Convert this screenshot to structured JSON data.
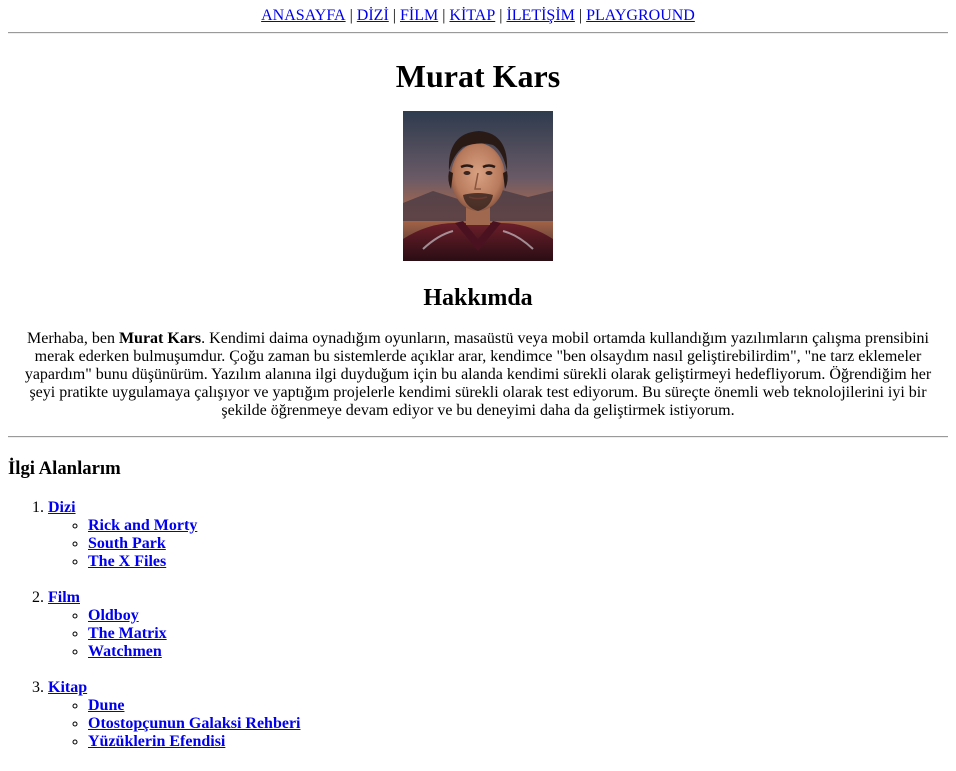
{
  "nav": {
    "links": [
      "ANASAYFA",
      "DİZİ",
      "FİLM",
      "KİTAP",
      "İLETİŞİM",
      "PLAYGROUND"
    ],
    "separator": "|"
  },
  "profile": {
    "name": "Murat Kars",
    "portrait_alt": "Murat Kars"
  },
  "about": {
    "heading": "Hakkımda",
    "intro": "Merhaba, ben ",
    "name_bold": "Murat Kars",
    "text": ". Kendimi daima oynadığım oyunların, masaüstü veya mobil ortamda kullandığım yazılımların çalışma prensibini merak ederken bulmuşumdur. Çoğu zaman bu sistemlerde açıklar arar, kendimce \"ben olsaydım nasıl geliştirebilirdim\", \"ne tarz eklemeler yapardım\" bunu düşünürüm. Yazılım alanına ilgi duyduğum için bu alanda kendimi sürekli olarak geliştirmeyi hedefliyorum. Öğrendiğim her şeyi pratikte uygulamaya çalışıyor ve yaptığım projelerle kendimi sürekli olarak test ediyorum. Bu süreçte önemli web teknolojilerini iyi bir şekilde öğrenmeye devam ediyor ve bu deneyimi daha da geliştirmek istiyorum."
  },
  "interests": {
    "heading": "İlgi Alanlarım",
    "categories": [
      {
        "label": "Dizi",
        "items": [
          "Rick and Morty",
          "South Park",
          "The X Files"
        ]
      },
      {
        "label": "Film",
        "items": [
          "Oldboy",
          "The Matrix",
          "Watchmen"
        ]
      },
      {
        "label": "Kitap",
        "items": [
          "Dune",
          "Otostopçunun Galaksi Rehberi",
          "Yüzüklerin Efendisi"
        ]
      }
    ]
  },
  "colors": {
    "link": "#0000ee",
    "rule": "#9a9a9a"
  }
}
